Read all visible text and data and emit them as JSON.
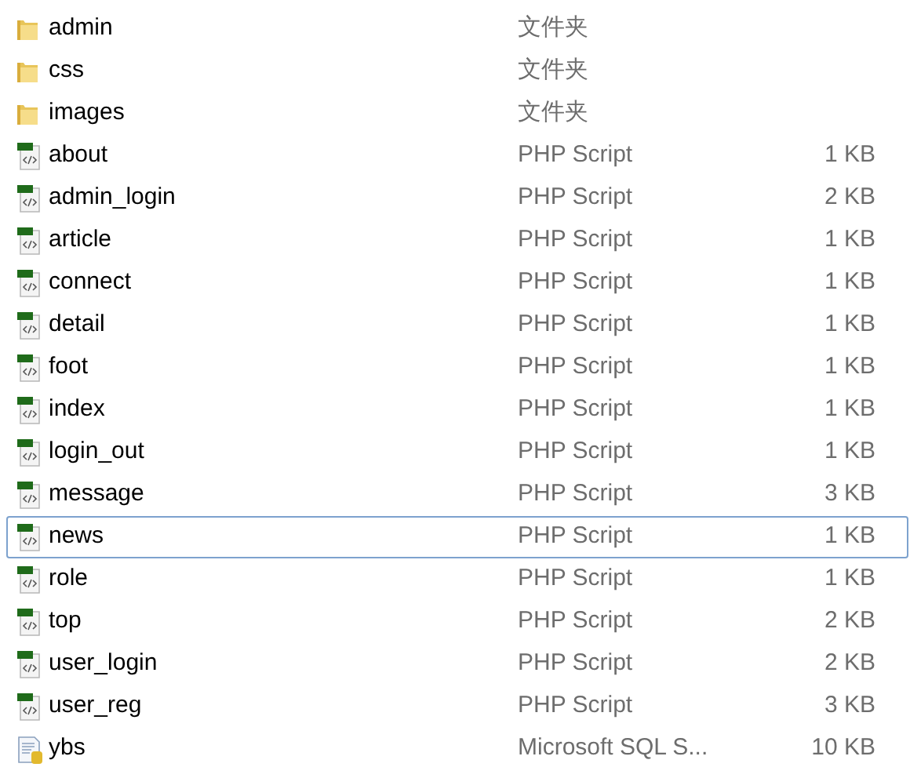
{
  "files": [
    {
      "kind": "folder",
      "name": "admin",
      "type": "文件夹",
      "focused": false
    },
    {
      "kind": "folder",
      "name": "css",
      "type": "文件夹",
      "focused": false
    },
    {
      "kind": "folder",
      "name": "images",
      "type": "文件夹",
      "focused": false
    },
    {
      "kind": "php",
      "name": "about",
      "type": "PHP Script",
      "size": "1 KB",
      "focused": false
    },
    {
      "kind": "php",
      "name": "admin_login",
      "type": "PHP Script",
      "size": "2 KB",
      "focused": false
    },
    {
      "kind": "php",
      "name": "article",
      "type": "PHP Script",
      "size": "1 KB",
      "focused": false
    },
    {
      "kind": "php",
      "name": "connect",
      "type": "PHP Script",
      "size": "1 KB",
      "focused": false
    },
    {
      "kind": "php",
      "name": "detail",
      "type": "PHP Script",
      "size": "1 KB",
      "focused": false
    },
    {
      "kind": "php",
      "name": "foot",
      "type": "PHP Script",
      "size": "1 KB",
      "focused": false
    },
    {
      "kind": "php",
      "name": "index",
      "type": "PHP Script",
      "size": "1 KB",
      "focused": false
    },
    {
      "kind": "php",
      "name": "login_out",
      "type": "PHP Script",
      "size": "1 KB",
      "focused": false
    },
    {
      "kind": "php",
      "name": "message",
      "type": "PHP Script",
      "size": "3 KB",
      "focused": false
    },
    {
      "kind": "php",
      "name": "news",
      "type": "PHP Script",
      "size": "1 KB",
      "focused": true
    },
    {
      "kind": "php",
      "name": "role",
      "type": "PHP Script",
      "size": "1 KB",
      "focused": false
    },
    {
      "kind": "php",
      "name": "top",
      "type": "PHP Script",
      "size": "2 KB",
      "focused": false
    },
    {
      "kind": "php",
      "name": "user_login",
      "type": "PHP Script",
      "size": "2 KB",
      "focused": false
    },
    {
      "kind": "php",
      "name": "user_reg",
      "type": "PHP Script",
      "size": "3 KB",
      "focused": false
    },
    {
      "kind": "sql",
      "name": "ybs",
      "type": "Microsoft SQL S...",
      "size": "10 KB",
      "focused": false
    }
  ]
}
